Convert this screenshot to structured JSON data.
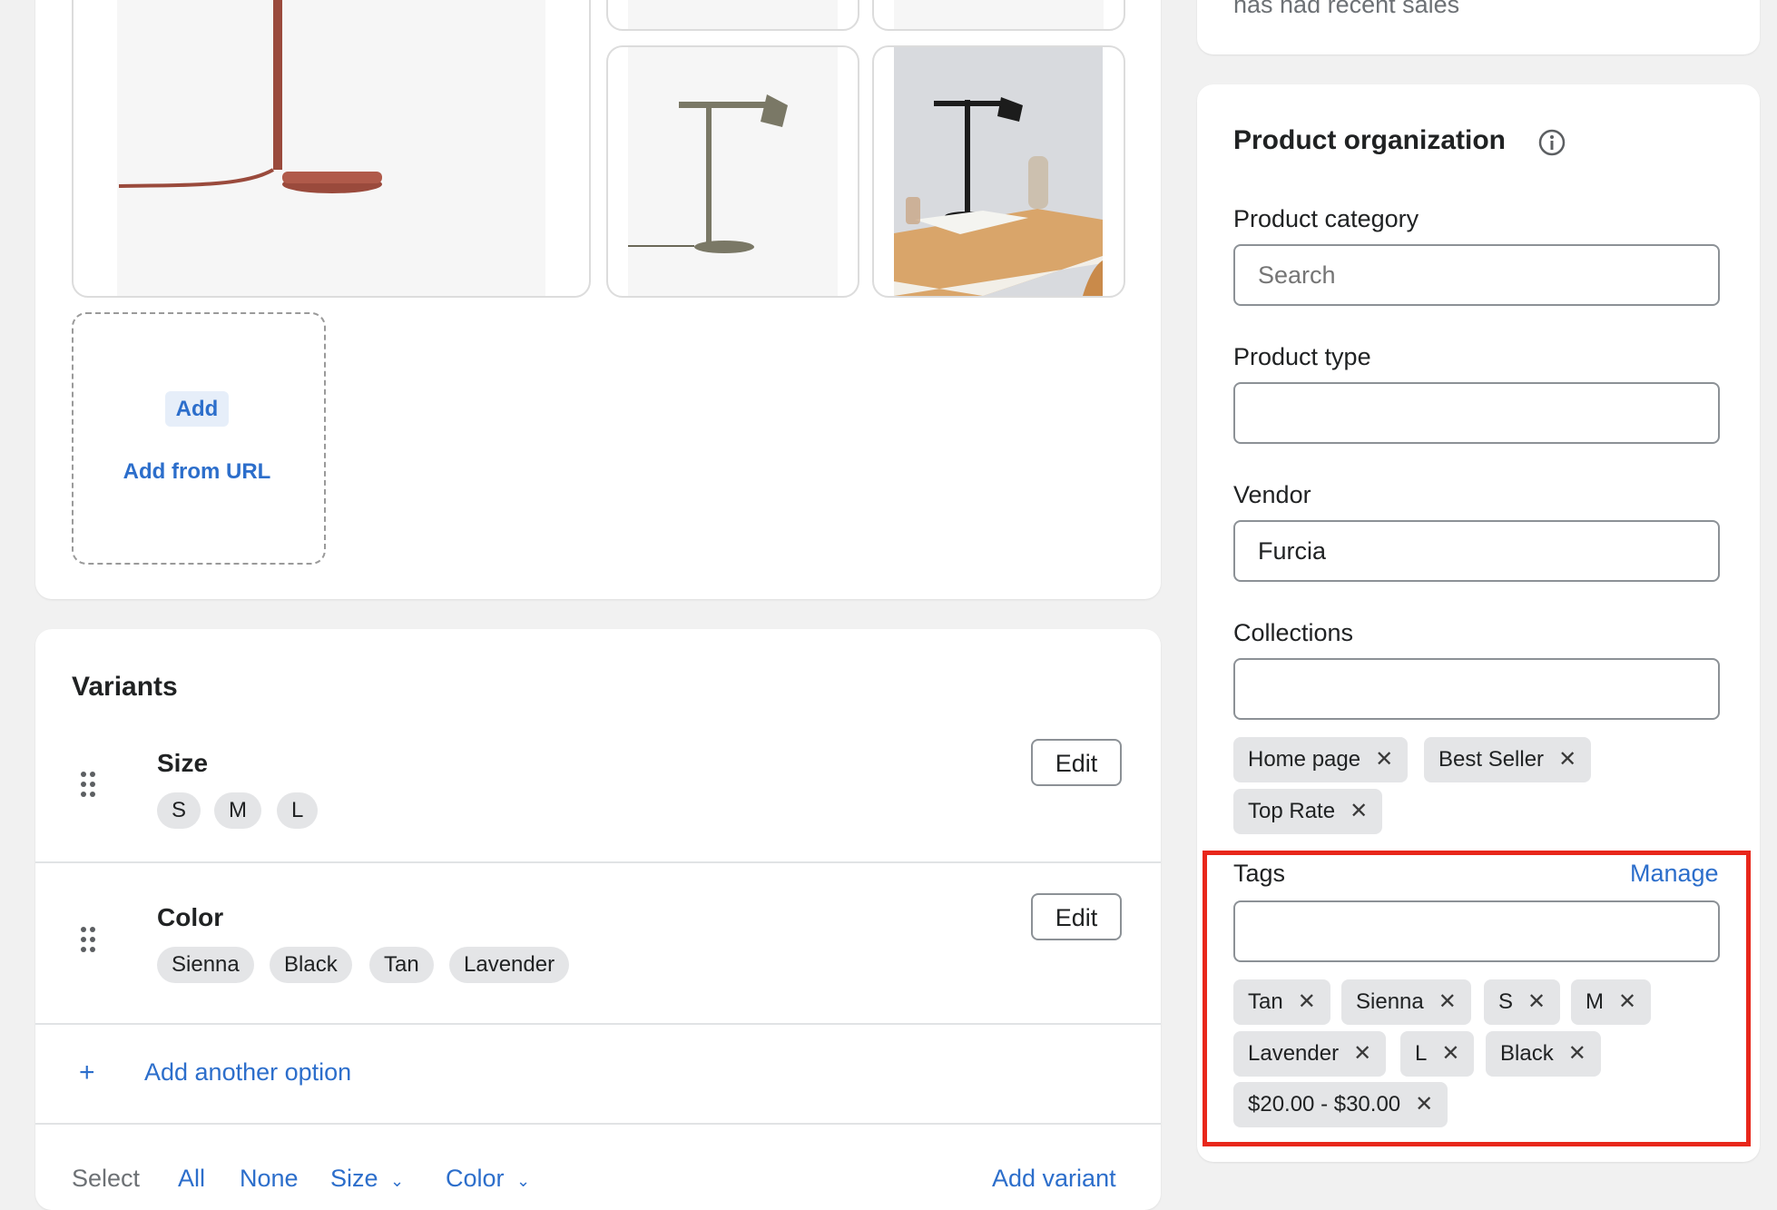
{
  "status": {
    "text": "has had recent sales"
  },
  "media": {
    "add_label": "Add",
    "add_url_label": "Add from URL"
  },
  "variants": {
    "title": "Variants",
    "options": [
      {
        "name": "Size",
        "values": [
          "S",
          "M",
          "L"
        ],
        "edit_label": "Edit"
      },
      {
        "name": "Color",
        "values": [
          "Sienna",
          "Black",
          "Tan",
          "Lavender"
        ],
        "edit_label": "Edit"
      }
    ],
    "add_option_icon": "+",
    "add_option_label": "Add another option",
    "select_bar": {
      "label": "Select",
      "all": "All",
      "none": "None",
      "size": "Size",
      "color": "Color",
      "add_variant": "Add variant"
    }
  },
  "organization": {
    "title": "Product organization",
    "category": {
      "label": "Product category",
      "placeholder": "Search"
    },
    "type": {
      "label": "Product type",
      "value": ""
    },
    "vendor": {
      "label": "Vendor",
      "value": "Furcia"
    },
    "collections": {
      "label": "Collections",
      "value": "",
      "items": [
        "Home page",
        "Best Seller",
        "Top Rate"
      ]
    },
    "tags": {
      "label": "Tags",
      "manage_label": "Manage",
      "value": "",
      "items": [
        "Tan",
        "Sienna",
        "S",
        "M",
        "Lavender",
        "L",
        "Black",
        "$20.00 - $30.00"
      ]
    }
  },
  "icons": {
    "remove": "✕",
    "chevron": "chevron-down-icon",
    "info": "info-icon",
    "drag": "drag-handle-icon"
  },
  "colors": {
    "accent": "#2c6ecb",
    "highlight": "#e8271b"
  }
}
